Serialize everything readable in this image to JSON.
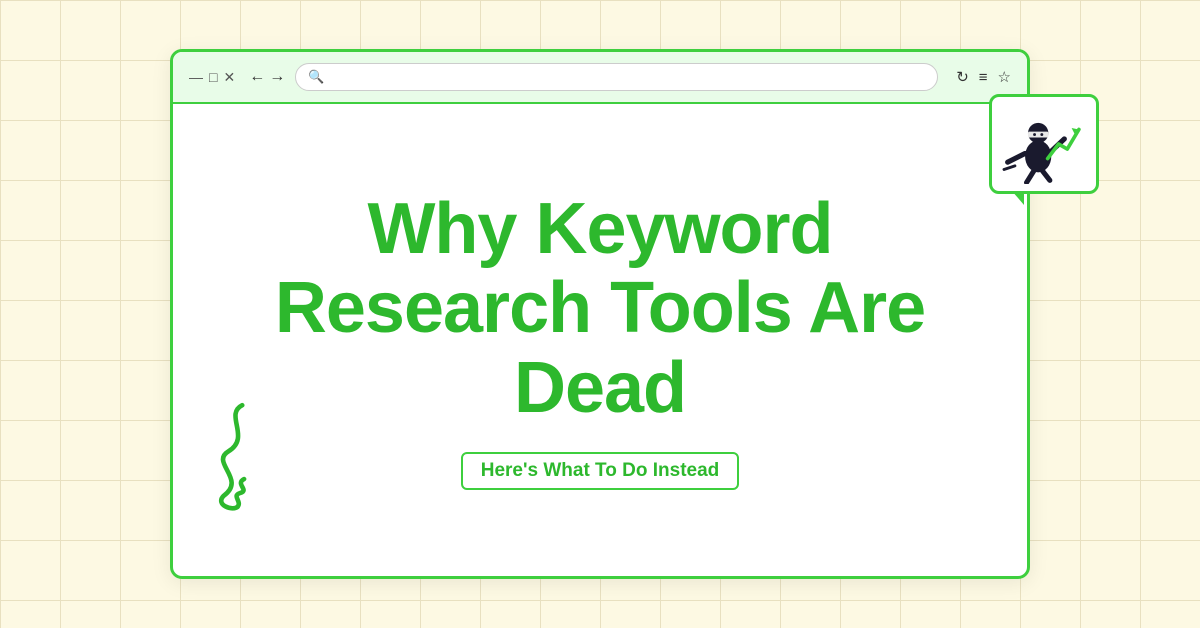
{
  "background": {
    "color": "#fdf9e3",
    "grid_color": "#e8e0c0"
  },
  "browser": {
    "window_controls": {
      "minimize": "—",
      "maximize": "□",
      "close": "✕"
    },
    "nav": {
      "back": "←",
      "forward": "→"
    },
    "toolbar_icons": {
      "refresh": "↻",
      "menu": "≡",
      "star": "☆"
    },
    "address_placeholder": ""
  },
  "content": {
    "main_title": "Why Keyword Research Tools Are Dead",
    "subtitle": "Here's What To Do Instead",
    "accent_color": "#2db82d",
    "border_color": "#3ecf3e"
  },
  "ninja_box": {
    "alt": "Ninja with trending arrow illustration"
  }
}
